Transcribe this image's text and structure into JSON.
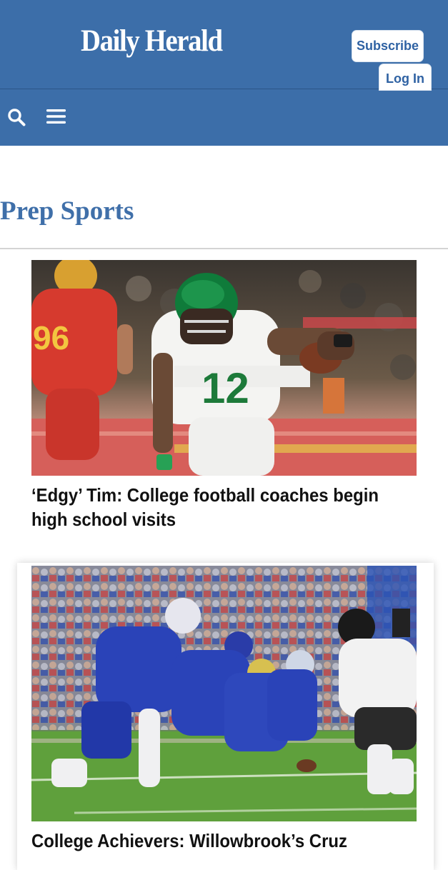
{
  "header": {
    "logo_text": "Daily Herald",
    "subscribe_label": "Subscribe",
    "login_label": "Log In",
    "brand_color": "#3c6ea9"
  },
  "nav": {
    "search_icon": "search-icon",
    "menu_icon": "hamburger-menu-icon"
  },
  "section": {
    "title": "Prep Sports",
    "title_color": "#3f6fa9"
  },
  "articles": [
    {
      "headline": "‘Edgy’ Tim: College football coaches begin high school visits",
      "image": "football-player-number-12-running-photo"
    },
    {
      "headline": "College Achievers: Willowbrook’s Cruz",
      "image": "football-line-of-scrimmage-photo"
    }
  ]
}
